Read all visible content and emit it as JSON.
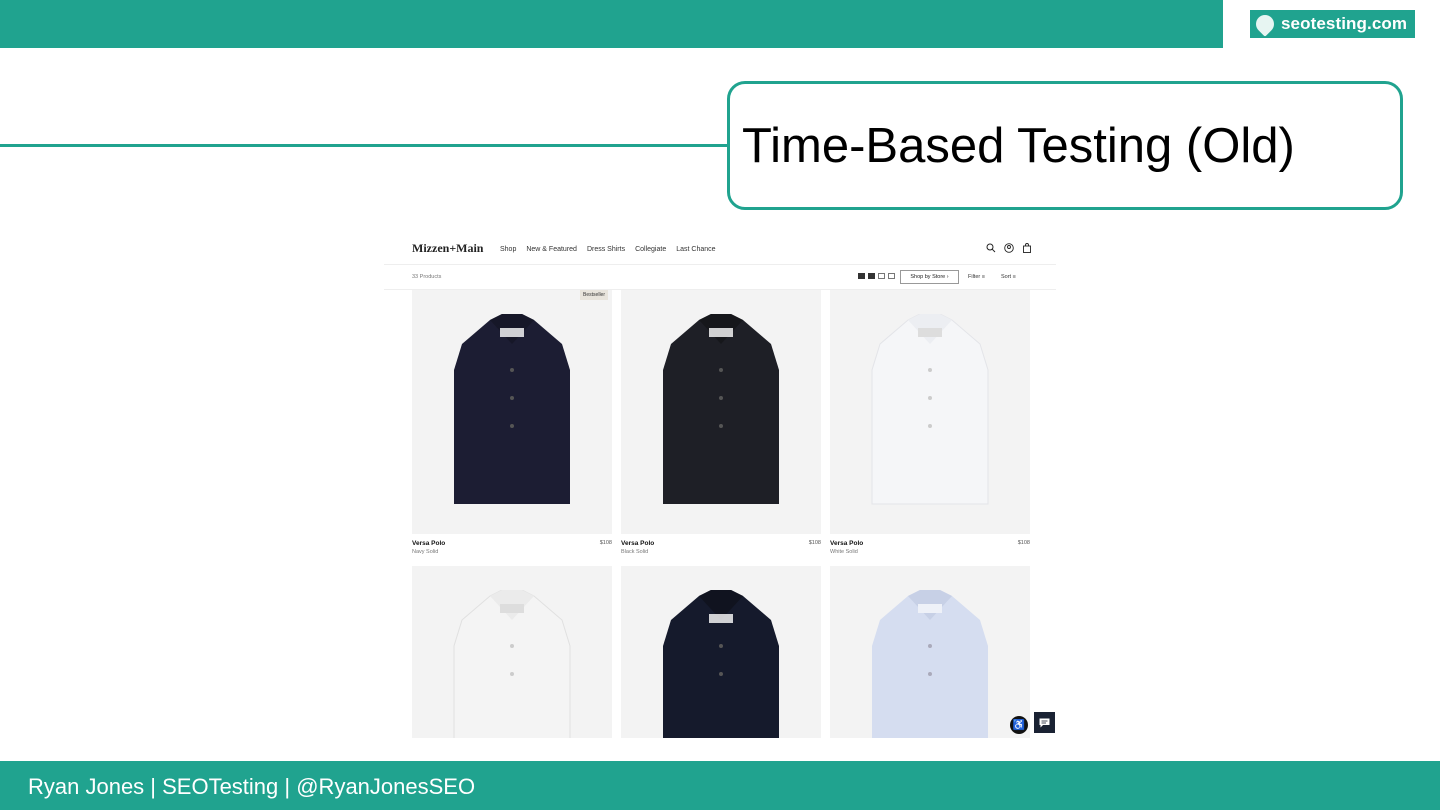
{
  "slide": {
    "brand": "seotesting.com",
    "title": "Time-Based Testing (Old)",
    "footer": "Ryan Jones | SEOTesting | @RyanJonesSEO",
    "colors": {
      "accent": "#20a38f",
      "title_text": "#000000"
    }
  },
  "site": {
    "logo": "Mizzen+Main",
    "nav": [
      "Shop",
      "New & Featured",
      "Dress Shirts",
      "Collegiate",
      "Last Chance"
    ],
    "icons": [
      "search-icon",
      "account-icon",
      "bag-icon"
    ],
    "product_count": "33 Products",
    "store_button": "Shop by Store",
    "filter_label": "Filter",
    "sort_label": "Sort",
    "products": [
      {
        "name": "Versa Polo",
        "variant": "Navy Solid",
        "price": "$108",
        "badge": "Bestseller",
        "color": "#1c1d33"
      },
      {
        "name": "Versa Polo",
        "variant": "Black Solid",
        "price": "$108",
        "color": "#1e1f26"
      },
      {
        "name": "Versa Polo",
        "variant": "White Solid",
        "price": "$108",
        "color": "#f5f6f8"
      },
      {
        "color": "#f4f4f4"
      },
      {
        "color": "#151a2c"
      },
      {
        "color": "#d5ddf0"
      }
    ]
  }
}
